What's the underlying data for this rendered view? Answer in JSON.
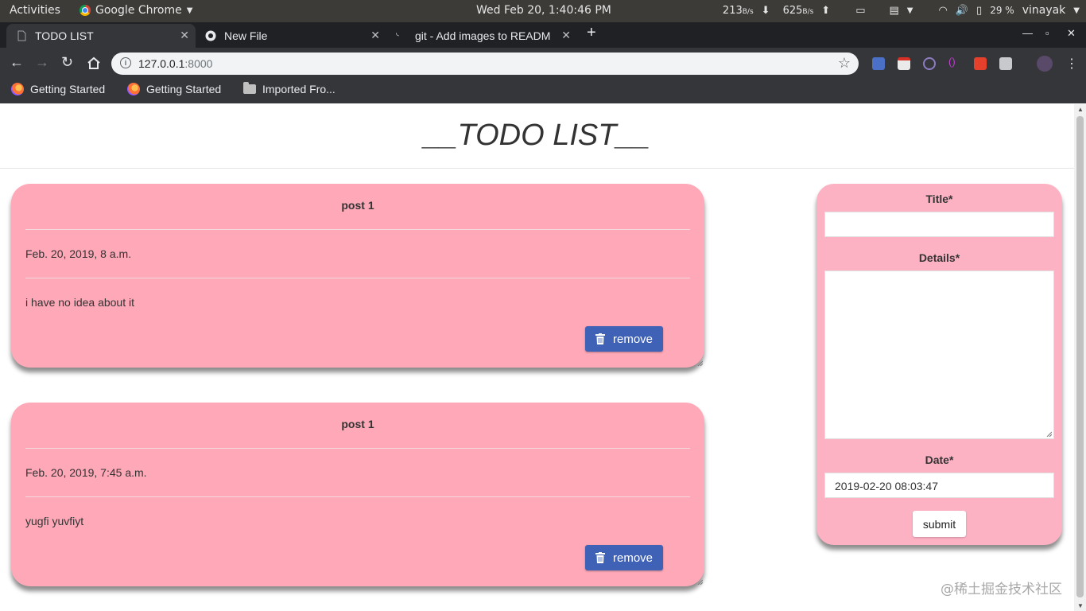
{
  "system_bar": {
    "activities": "Activities",
    "app_name": "Google Chrome",
    "clock": "Wed Feb 20,  1:40:46 PM",
    "net_down_value": "213",
    "net_down_unit": "B/s",
    "net_up_value": "625",
    "net_up_unit": "B/s",
    "battery": "29 %",
    "user": "vinayak"
  },
  "tabs": [
    {
      "title": "TODO LIST"
    },
    {
      "title": "New File"
    },
    {
      "title": "git - Add images to READM"
    }
  ],
  "address_bar": {
    "host": "127.0.0.1",
    "port": ":8000"
  },
  "bookmarks": [
    {
      "label": "Getting Started"
    },
    {
      "label": "Getting Started"
    },
    {
      "label": "Imported Fro..."
    }
  ],
  "page": {
    "title": "__TODO LIST__"
  },
  "posts": [
    {
      "title": "post 1",
      "date": "Feb. 20, 2019, 8 a.m.",
      "details": "i have no idea about it",
      "remove_label": "remove"
    },
    {
      "title": "post 1",
      "date": "Feb. 20, 2019, 7:45 a.m.",
      "details": "yugfi yuvfiyt",
      "remove_label": "remove"
    }
  ],
  "form": {
    "title_label": "Title*",
    "details_label": "Details*",
    "date_label": "Date*",
    "date_value": "2019-02-20 08:03:47",
    "submit_label": "submit"
  },
  "watermark": "@稀土掘金技术社区",
  "colors": {
    "card_bg": "#fea8b8",
    "form_bg": "#fdb2c4",
    "remove_button": "#3f62b6"
  }
}
